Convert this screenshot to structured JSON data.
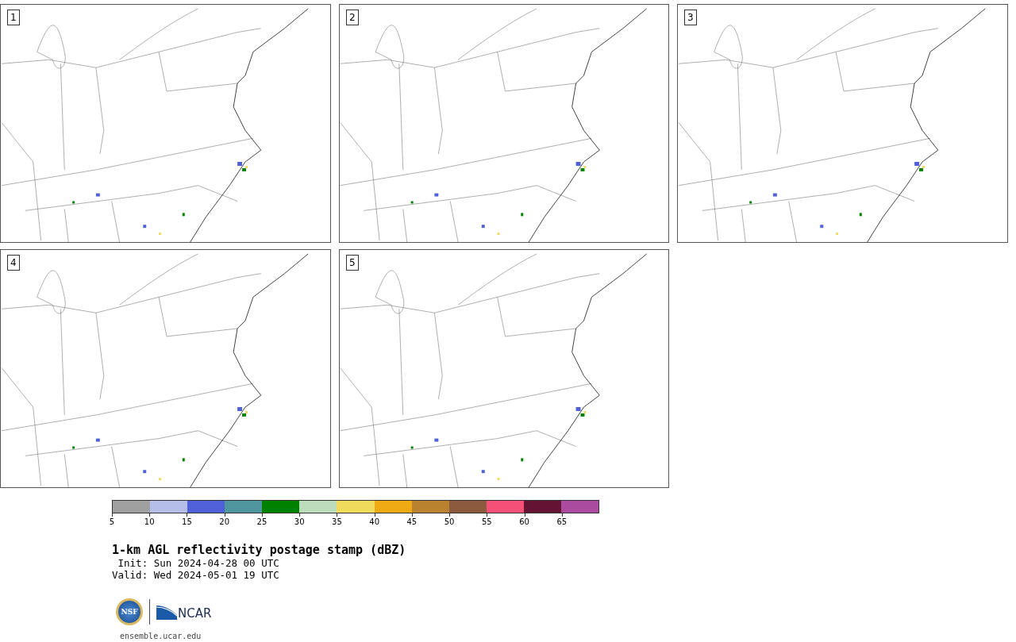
{
  "panels": [
    {
      "label": "1"
    },
    {
      "label": "2"
    },
    {
      "label": "3"
    },
    {
      "label": "4"
    },
    {
      "label": "5"
    }
  ],
  "colorbar": {
    "segments": [
      {
        "color": "#a0a0a0",
        "label": "5"
      },
      {
        "color": "#b4bee8",
        "label": "10"
      },
      {
        "color": "#5060d8",
        "label": "15"
      },
      {
        "color": "#50969e",
        "label": "20"
      },
      {
        "color": "#008200",
        "label": "25"
      },
      {
        "color": "#bcdcbc",
        "label": "30"
      },
      {
        "color": "#f0dc5a",
        "label": "35"
      },
      {
        "color": "#f0aa14",
        "label": "40"
      },
      {
        "color": "#b8822e",
        "label": "45"
      },
      {
        "color": "#8c5a3c",
        "label": "50"
      },
      {
        "color": "#f55078",
        "label": "55"
      },
      {
        "color": "#641432",
        "label": "60"
      },
      {
        "color": "#aa4ba0",
        "label": "65"
      }
    ]
  },
  "title": "1-km AGL reflectivity postage stamp (dBZ)",
  "init": " Init: Sun 2024-04-28 00 UTC",
  "valid": "Valid: Wed 2024-05-01 19 UTC",
  "logos": {
    "nsf": "NSF",
    "ncar": "NCAR"
  },
  "url": "ensemble.ucar.edu"
}
